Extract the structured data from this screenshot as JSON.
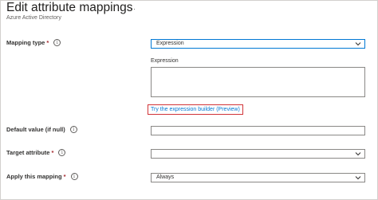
{
  "header": {
    "title": "Edit attribute mappings",
    "subtitle": "Azure Active Directory",
    "more_label": "···"
  },
  "fields": {
    "mapping_type": {
      "label": "Mapping type",
      "required_mark": "*",
      "value": "Expression"
    },
    "expression": {
      "label": "Expression",
      "value": "",
      "builder_link": "Try the expression builder (Preview)"
    },
    "default_value": {
      "label": "Default value (if null)",
      "value": ""
    },
    "target_attribute": {
      "label": "Target attribute",
      "required_mark": "*",
      "value": ""
    },
    "apply_mapping": {
      "label": "Apply this mapping",
      "required_mark": "*",
      "value": "Always"
    }
  },
  "icons": {
    "info": "info-icon",
    "chevron": "chevron-down-icon"
  },
  "colors": {
    "accent": "#0078d4",
    "required": "#a4262c",
    "highlight_border": "#d13438"
  }
}
